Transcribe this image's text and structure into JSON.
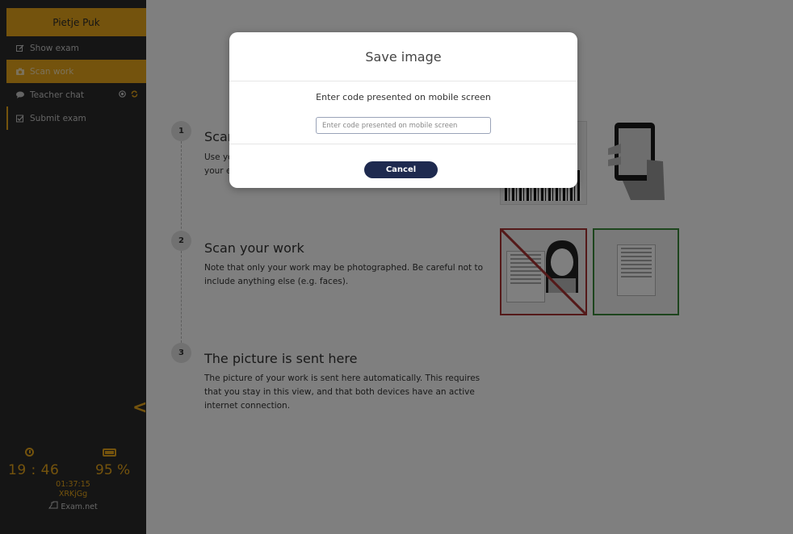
{
  "sidebar": {
    "user_name": "Pietje Puk",
    "items": [
      {
        "label": "Show exam",
        "icon": "edit-icon"
      },
      {
        "label": "Scan work",
        "icon": "camera-icon",
        "active": true
      },
      {
        "label": "Teacher chat",
        "icon": "chat-icon"
      },
      {
        "label": "Submit exam",
        "icon": "checkbox-icon"
      }
    ],
    "collapse_glyph": "<"
  },
  "status": {
    "time": "19 : 46",
    "battery": "95 %",
    "elapsed": "01:37:15",
    "code": "XRKjGg",
    "brand": "Exam.net",
    "accent_color": "#e9a71a"
  },
  "steps": [
    {
      "number": "1",
      "title": "Scan",
      "text": "Use yo\nyour e"
    },
    {
      "number": "2",
      "title": "Scan your work",
      "text": "Note that only your work may be photographed. Be careful not to include anything else (e.g. faces)."
    },
    {
      "number": "3",
      "title": "The picture is sent here",
      "text": "The picture of your work is sent here automatically. This requires that you stay in this view, and that both devices have an active internet connection."
    }
  ],
  "modal": {
    "title": "Save image",
    "prompt": "Enter code presented on mobile screen",
    "input_placeholder": "Enter code presented on mobile screen",
    "input_value": "",
    "cancel_label": "Cancel"
  }
}
